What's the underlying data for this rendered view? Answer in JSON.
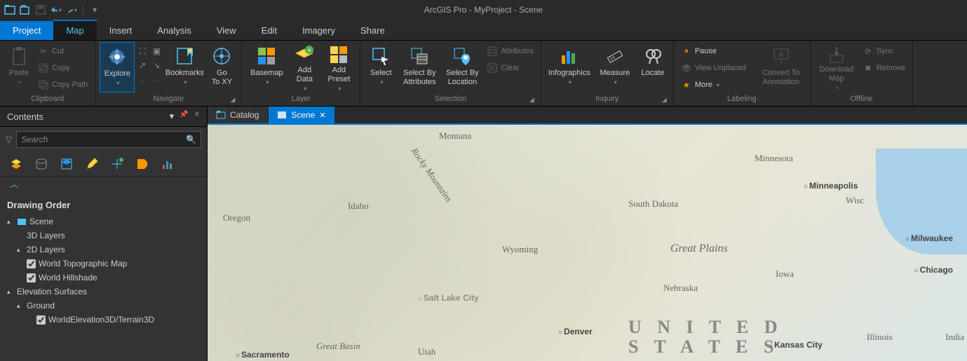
{
  "app_title": "ArcGIS Pro - MyProject - Scene",
  "qat": {
    "undo_label": "",
    "redo_label": ""
  },
  "ribbon_tabs": {
    "project": "Project",
    "map": "Map",
    "insert": "Insert",
    "analysis": "Analysis",
    "view": "View",
    "edit": "Edit",
    "imagery": "Imagery",
    "share": "Share"
  },
  "clipboard": {
    "paste": "Paste",
    "cut": "Cut",
    "copy": "Copy",
    "copy_path": "Copy Path",
    "group_label": "Clipboard"
  },
  "navigate": {
    "explore": "Explore",
    "bookmarks": "Bookmarks",
    "go_to_xy": "Go\nTo XY",
    "group_label": "Navigate"
  },
  "layer": {
    "basemap": "Basemap",
    "add_data": "Add\nData",
    "add_preset": "Add\nPreset",
    "group_label": "Layer"
  },
  "selection": {
    "select": "Select",
    "by_attr": "Select By\nAttributes",
    "by_loc": "Select By\nLocation",
    "attributes": "Attributes",
    "clear": "Clear",
    "group_label": "Selection"
  },
  "inquiry": {
    "infographics": "Infographics",
    "measure": "Measure",
    "locate": "Locate",
    "group_label": "Inquiry"
  },
  "labeling": {
    "pause": "Pause",
    "view_unplaced": "View Unplaced",
    "more": "More",
    "convert": "Convert To\nAnnotation",
    "group_label": "Labeling"
  },
  "offline": {
    "download": "Download\nMap",
    "sync": "Sync",
    "remove": "Remove",
    "group_label": "Offline"
  },
  "contents": {
    "title": "Contents",
    "search_placeholder": "Search",
    "drawing_order": "Drawing Order",
    "scene": "Scene",
    "layers_3d": "3D Layers",
    "layers_2d": "2D Layers",
    "world_topo": "World Topographic Map",
    "world_hill": "World Hillshade",
    "elev_surfaces": "Elevation Surfaces",
    "ground": "Ground",
    "terrain3d": "WorldElevation3D/Terrain3D"
  },
  "doc_tabs": {
    "catalog": "Catalog",
    "scene": "Scene"
  },
  "map_labels": {
    "montana": "Montana",
    "idaho": "Idaho",
    "oregon": "Oregon",
    "wyoming": "Wyoming",
    "south_dakota": "South Dakota",
    "nebraska": "Nebraska",
    "iowa": "Iowa",
    "wisc": "Wisc",
    "illinois": "Illinois",
    "india": "India",
    "utah": "Utah",
    "rocky": "Rocky Mountains",
    "great_plains": "Great Plains",
    "great_basin": "Great Basin",
    "united_states": "U N I T E D\nS T A T E S",
    "minnesota": "Minnesota",
    "salt_lake": "Salt Lake City",
    "denver": "Denver",
    "minneapolis": "Minneapolis",
    "milwaukee": "Milwaukee",
    "chicago": "Chicago",
    "kansas_city": "Kansas City",
    "sacramento": "Sacramento"
  }
}
